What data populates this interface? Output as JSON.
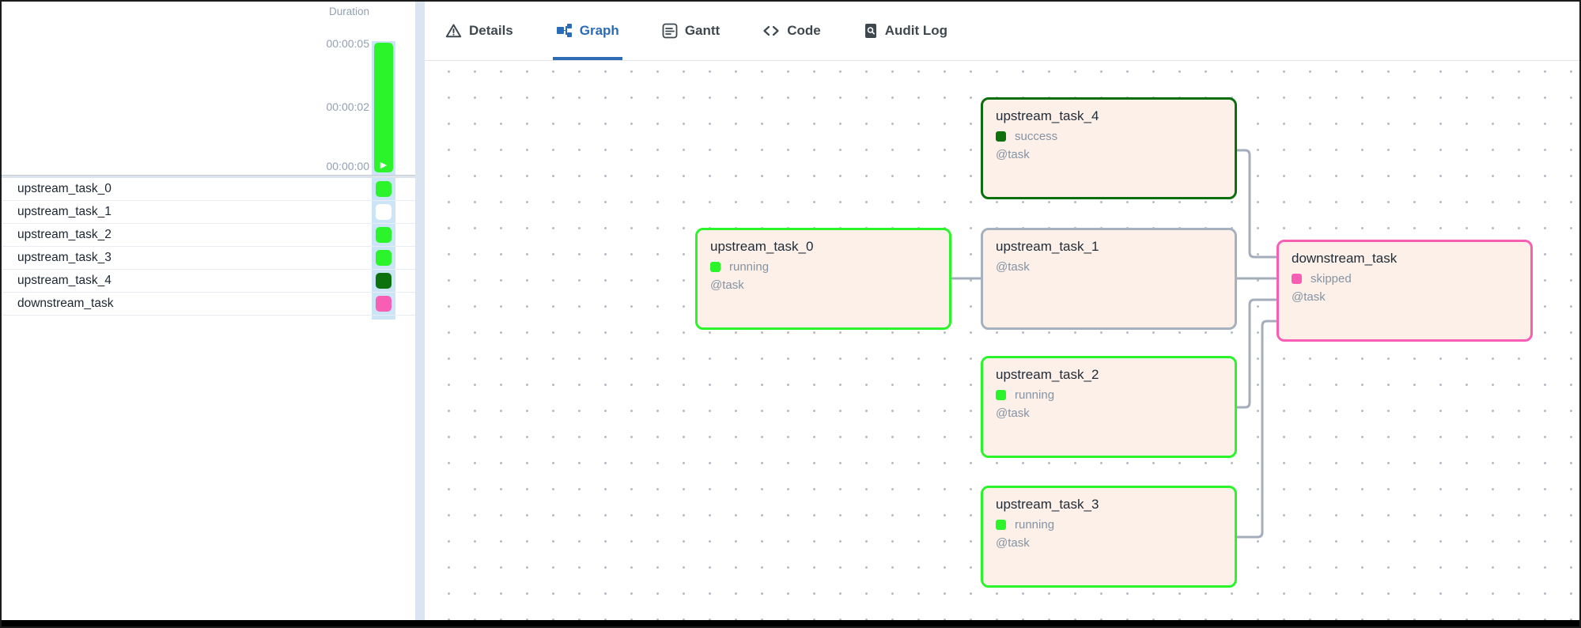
{
  "colors": {
    "accent_blue": "#2e6db4",
    "running_green": "#2bf42b",
    "success_green": "#0d720d",
    "skipped_pink": "#f85eb4",
    "no_status_white": "#ffffff",
    "node_background": "#fcf0e9",
    "edge_gray": "#a4aebb",
    "status_column_blue": "#cbe5f7"
  },
  "left_panel": {
    "duration_chart": {
      "type": "bar",
      "title": "Duration",
      "ticks": [
        "00:00:05",
        "00:00:02",
        "00:00:00"
      ],
      "bar_value": "00:00:05",
      "bar_color": "#2bf42b",
      "play_icon": "▶"
    },
    "tasks": [
      {
        "name": "upstream_task_0",
        "status": "running",
        "color": "#2bf42b"
      },
      {
        "name": "upstream_task_1",
        "status": "no_status",
        "color": "#ffffff"
      },
      {
        "name": "upstream_task_2",
        "status": "running",
        "color": "#2bf42b"
      },
      {
        "name": "upstream_task_3",
        "status": "running",
        "color": "#2bf42b"
      },
      {
        "name": "upstream_task_4",
        "status": "success",
        "color": "#0d720d"
      },
      {
        "name": "downstream_task",
        "status": "skipped",
        "color": "#f85eb4"
      }
    ]
  },
  "tabs": [
    {
      "label": "Details",
      "icon": "warning-icon",
      "active": false
    },
    {
      "label": "Graph",
      "icon": "graph-icon",
      "active": true
    },
    {
      "label": "Gantt",
      "icon": "gantt-icon",
      "active": false
    },
    {
      "label": "Code",
      "icon": "code-icon",
      "active": false
    },
    {
      "label": "Audit Log",
      "icon": "audit-log-icon",
      "active": false
    }
  ],
  "graph": {
    "nodes": [
      {
        "id": "upstream_task_0",
        "title": "upstream_task_0",
        "status": "running",
        "subtitle": "@task"
      },
      {
        "id": "upstream_task_1",
        "title": "upstream_task_1",
        "status": "",
        "subtitle": "@task"
      },
      {
        "id": "upstream_task_2",
        "title": "upstream_task_2",
        "status": "running",
        "subtitle": "@task"
      },
      {
        "id": "upstream_task_3",
        "title": "upstream_task_3",
        "status": "running",
        "subtitle": "@task"
      },
      {
        "id": "upstream_task_4",
        "title": "upstream_task_4",
        "status": "success",
        "subtitle": "@task"
      },
      {
        "id": "downstream_task",
        "title": "downstream_task",
        "status": "skipped",
        "subtitle": "@task"
      }
    ],
    "edges": [
      {
        "from": "upstream_task_0",
        "to": "upstream_task_1"
      },
      {
        "from": "upstream_task_1",
        "to": "downstream_task"
      },
      {
        "from": "upstream_task_2",
        "to": "downstream_task"
      },
      {
        "from": "upstream_task_3",
        "to": "downstream_task"
      },
      {
        "from": "upstream_task_4",
        "to": "downstream_task"
      }
    ]
  }
}
